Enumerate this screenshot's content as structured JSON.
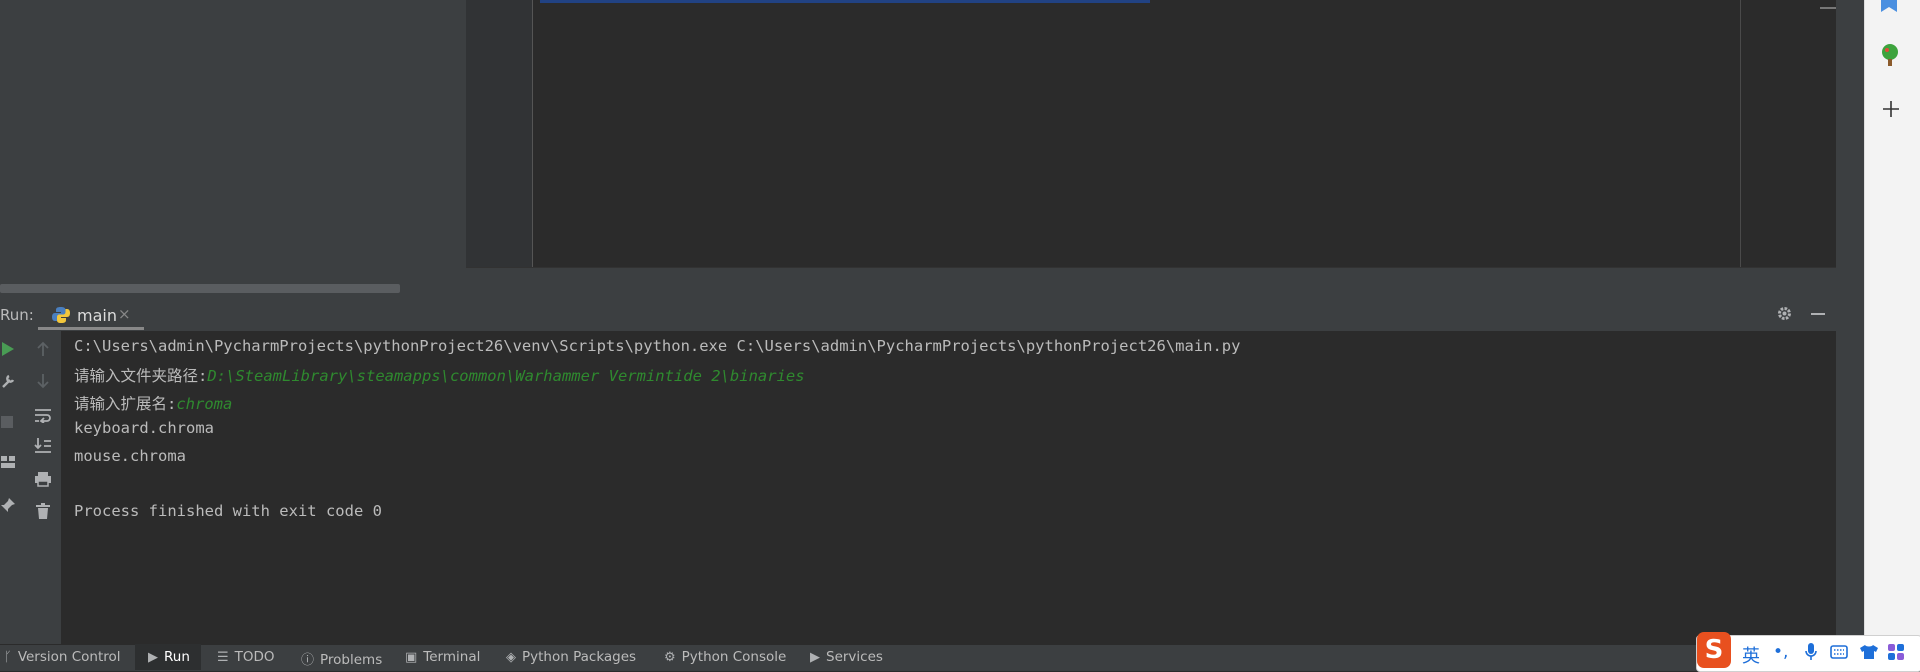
{
  "run_window": {
    "label": "Run:",
    "tab_label": "main",
    "tab_close": "×"
  },
  "console": {
    "command_line": "C:\\Users\\admin\\PycharmProjects\\pythonProject26\\venv\\Scripts\\python.exe C:\\Users\\admin\\PycharmProjects\\pythonProject26\\main.py",
    "prompt_path": "请输入文件夹路径:",
    "input_path": "D:\\SteamLibrary\\steamapps\\common\\Warhammer Vermintide 2\\binaries",
    "prompt_ext": "请输入扩展名:",
    "input_ext": "chroma",
    "result_1": "keyboard.chroma",
    "result_2": "mouse.chroma",
    "exit_message": "Process finished with exit code 0"
  },
  "status_bar": {
    "version_control": "Version Control",
    "run": "Run",
    "todo": "TODO",
    "problems": "Problems",
    "terminal": "Terminal",
    "python_packages": "Python Packages",
    "python_console": "Python Console",
    "services": "Services"
  },
  "ime": {
    "logo": "S",
    "lang": "英"
  },
  "colors": {
    "accent_input": "#2f8a2f",
    "run_icon": "#499c54",
    "ime_logo": "#e8501f"
  }
}
